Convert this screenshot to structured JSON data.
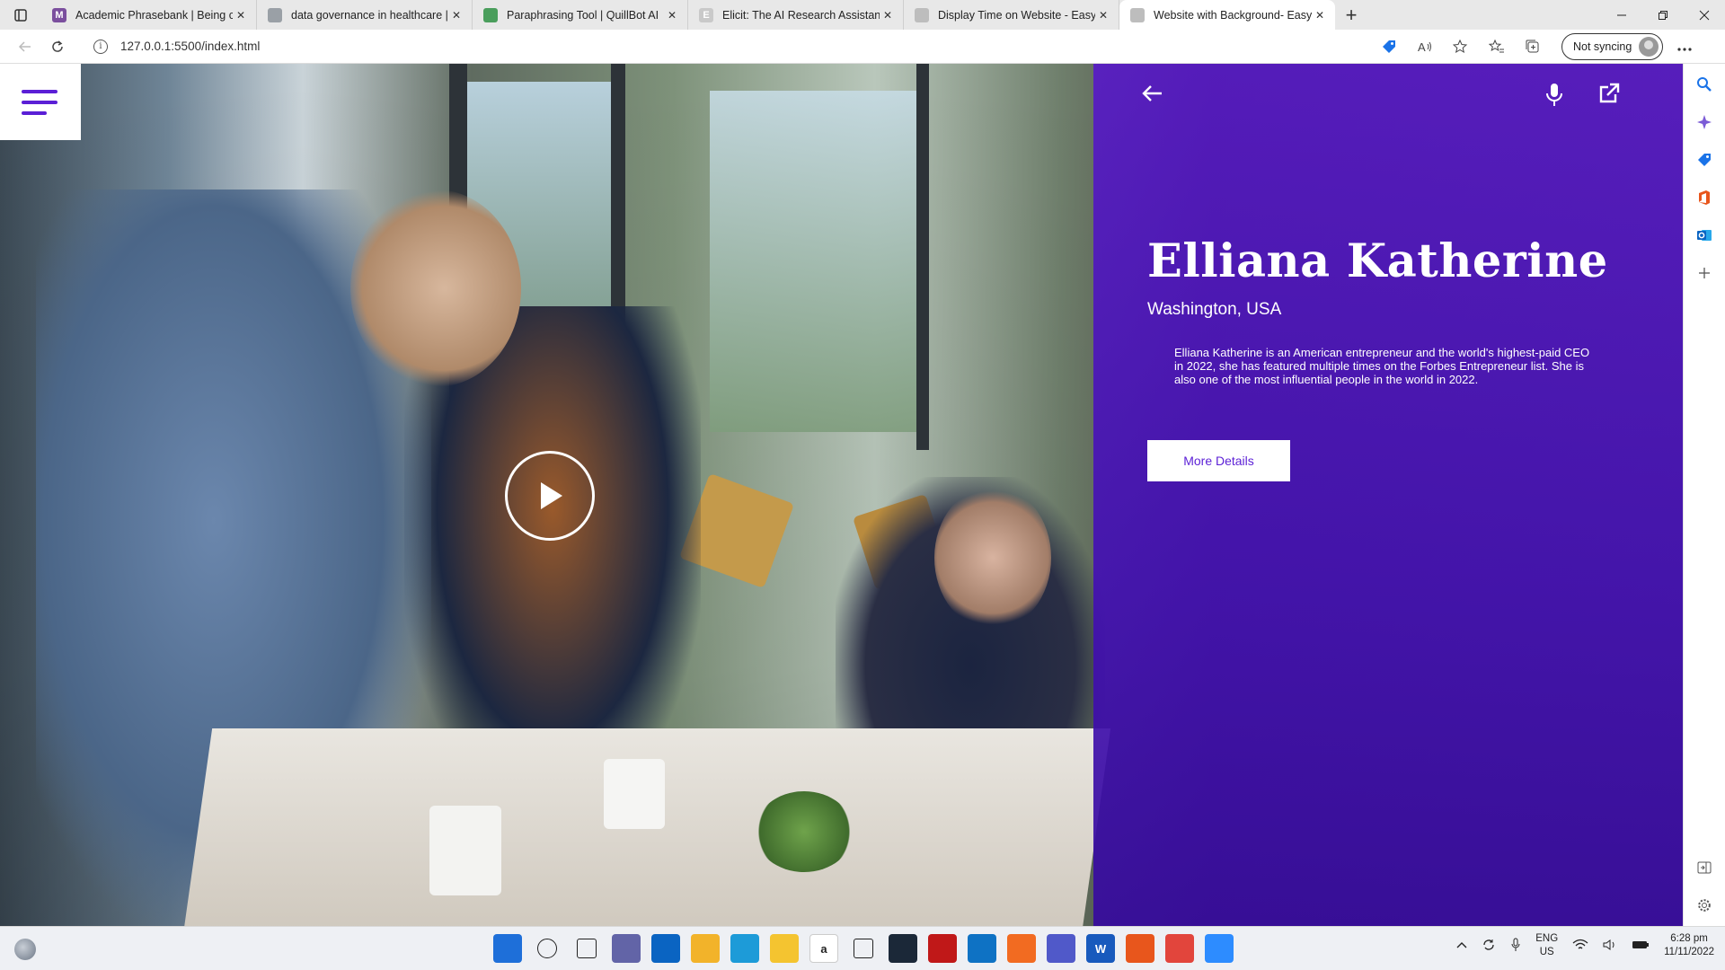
{
  "browser": {
    "tabs": [
      {
        "title": "Academic Phrasebank | Being ca",
        "favicon": "M",
        "favicon_color": "#7b4f9e",
        "active": false
      },
      {
        "title": "data governance in healthcare |",
        "favicon": "",
        "favicon_color": "#9aa0a6",
        "active": false
      },
      {
        "title": "Paraphrasing Tool | QuillBot AI",
        "favicon": "",
        "favicon_color": "#4a9e5c",
        "active": false
      },
      {
        "title": "Elicit: The AI Research Assistant",
        "favicon": "E",
        "favicon_color": "#c9c9c9",
        "active": false
      },
      {
        "title": "Display Time on Website - Easy",
        "favicon": "",
        "favicon_color": "#bdbdbd",
        "active": false
      },
      {
        "title": "Website with Background- Easy",
        "favicon": "",
        "favicon_color": "#bdbdbd",
        "active": true
      }
    ],
    "new_tab": "+",
    "url": "127.0.0.1:5500/index.html",
    "sync_label": "Not syncing"
  },
  "hero": {
    "name": "Elliana Katherine",
    "location": "Washington, USA",
    "description": "Elliana Katherine is an American entrepreneur and the world's highest-paid CEO in 2022, she has featured multiple times on the Forbes Entrepreneur list. She is also one of the most influential people in the world in 2022.",
    "button_label": "More Details",
    "accent_color": "#5b1fd6"
  },
  "taskbar": {
    "language_top": "ENG",
    "language_bottom": "US",
    "time": "6:28 pm",
    "date": "11/11/2022",
    "apps": [
      {
        "name": "start-icon",
        "glyph": "",
        "color": "#1e6fd9"
      },
      {
        "name": "search-icon",
        "glyph": "",
        "color": "transparent"
      },
      {
        "name": "task-view-icon",
        "glyph": "",
        "color": "transparent"
      },
      {
        "name": "teams-chat-icon",
        "glyph": "",
        "color": "#6264a7"
      },
      {
        "name": "mail-icon",
        "glyph": "",
        "color": "#0a64c2"
      },
      {
        "name": "file-explorer-icon",
        "glyph": "",
        "color": "#f2b32a"
      },
      {
        "name": "edge-icon",
        "glyph": "",
        "color": "#1d9bd8"
      },
      {
        "name": "norton-icon",
        "glyph": "",
        "color": "#f4c430"
      },
      {
        "name": "amazon-icon",
        "glyph": "a",
        "color": "#ffffff"
      },
      {
        "name": "dropbox-icon",
        "glyph": "",
        "color": "transparent"
      },
      {
        "name": "steam-icon",
        "glyph": "",
        "color": "#1b2838"
      },
      {
        "name": "mcafee-icon",
        "glyph": "",
        "color": "#c01818"
      },
      {
        "name": "vscode-icon",
        "glyph": "",
        "color": "#0e72c4"
      },
      {
        "name": "avast-icon",
        "glyph": "",
        "color": "#f26b21"
      },
      {
        "name": "teams-icon",
        "glyph": "",
        "color": "#5059c9"
      },
      {
        "name": "word-icon",
        "glyph": "W",
        "color": "#185abd"
      },
      {
        "name": "office-icon",
        "glyph": "",
        "color": "#e8561c"
      },
      {
        "name": "chrome-icon",
        "glyph": "",
        "color": "#e2453c"
      },
      {
        "name": "zoom-icon",
        "glyph": "",
        "color": "#2d8cff"
      }
    ]
  }
}
